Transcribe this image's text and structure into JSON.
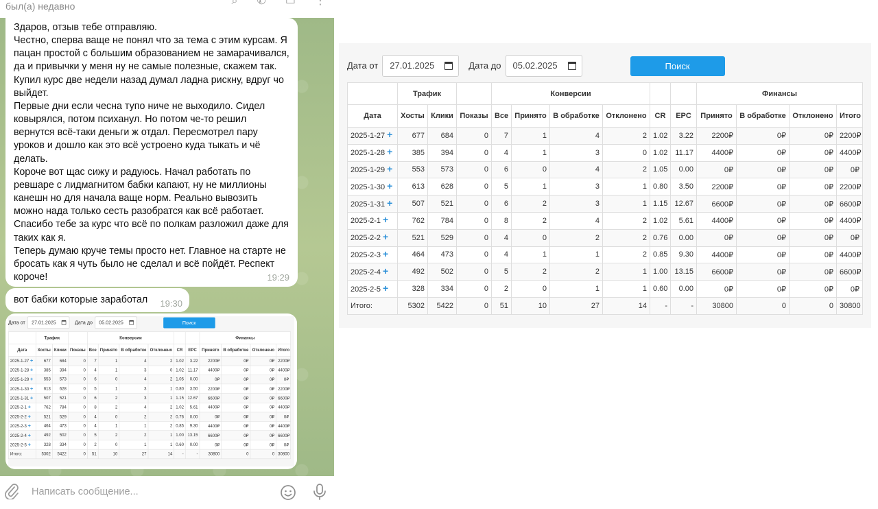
{
  "chat": {
    "status": "был(а) недавно",
    "messages": [
      {
        "text": "Здаров, отзыв тебе отправляю.\nЧестно, сперва ваще не понял что за тема с этим курсам. Я пацан простой с большим образованием не замарачивался, да и привычки у меня ну не самые полезные, скажем так. Купил курс две недели назад думал ладна рискну, вдруг чо выйдет.\nПервые дни если чесна тупо ниче не выходило. Сидел ковырялся, потом психанул. Но потом че-то решил вернутся всё-таки деньги ж отдал. Пересмотрел пару уроков и дошло как это всё устроено куда тыкать и чё делать.\nКороче вот щас сижу и радуюсь. Начал работать по ревшаре с лидмагнитом бабки капают, ну не миллионы канешн но для начала ваще норм. Реально вывозить можно нада только сесть разобратся как всё работает.\nСпасибо тебе за курс что всё по полкам разложил даже для таких как я.\nТеперь думаю круче темы просто нет. Главное на старте не бросать как я чуть было не сделал и всё пойдёт. Респект короче!",
        "time": "19:29"
      },
      {
        "text": "вот бабки которые заработал",
        "time": "19:30"
      }
    ],
    "composer_placeholder": "Написать сообщение..."
  },
  "report": {
    "date_from_label": "Дата от",
    "date_from_value": "27.01.2025",
    "date_to_label": "Дата до",
    "date_to_value": "05.02.2025",
    "search_button": "Поиск",
    "group_headers": {
      "traffic": "Трафик",
      "conversions": "Конверсии",
      "finance": "Финансы"
    },
    "columns": [
      "Дата",
      "Хосты",
      "Клики",
      "Показы",
      "Все",
      "Принято",
      "В обработке",
      "Отклонено",
      "CR",
      "EPC",
      "Принято",
      "В обработке",
      "Отклонено",
      "Итого"
    ],
    "rows": [
      [
        "2025-1-27",
        "677",
        "684",
        "0",
        "7",
        "1",
        "4",
        "2",
        "1.02",
        "3.22",
        "2200₽",
        "0₽",
        "0₽",
        "2200₽"
      ],
      [
        "2025-1-28",
        "385",
        "394",
        "0",
        "4",
        "1",
        "3",
        "0",
        "1.02",
        "11.17",
        "4400₽",
        "0₽",
        "0₽",
        "4400₽"
      ],
      [
        "2025-1-29",
        "553",
        "573",
        "0",
        "6",
        "0",
        "4",
        "2",
        "1.05",
        "0.00",
        "0₽",
        "0₽",
        "0₽",
        "0₽"
      ],
      [
        "2025-1-30",
        "613",
        "628",
        "0",
        "5",
        "1",
        "3",
        "1",
        "0.80",
        "3.50",
        "2200₽",
        "0₽",
        "0₽",
        "2200₽"
      ],
      [
        "2025-1-31",
        "507",
        "521",
        "0",
        "6",
        "2",
        "3",
        "1",
        "1.15",
        "12.67",
        "6600₽",
        "0₽",
        "0₽",
        "6600₽"
      ],
      [
        "2025-2-1",
        "762",
        "784",
        "0",
        "8",
        "2",
        "4",
        "2",
        "1.02",
        "5.61",
        "4400₽",
        "0₽",
        "0₽",
        "4400₽"
      ],
      [
        "2025-2-2",
        "521",
        "529",
        "0",
        "4",
        "0",
        "2",
        "2",
        "0.76",
        "0.00",
        "0₽",
        "0₽",
        "0₽",
        "0₽"
      ],
      [
        "2025-2-3",
        "464",
        "473",
        "0",
        "4",
        "1",
        "1",
        "2",
        "0.85",
        "9.30",
        "4400₽",
        "0₽",
        "0₽",
        "4400₽"
      ],
      [
        "2025-2-4",
        "492",
        "502",
        "0",
        "5",
        "2",
        "2",
        "1",
        "1.00",
        "13.15",
        "6600₽",
        "0₽",
        "0₽",
        "6600₽"
      ],
      [
        "2025-2-5",
        "328",
        "334",
        "0",
        "2",
        "0",
        "1",
        "1",
        "0.60",
        "0.00",
        "0₽",
        "0₽",
        "0₽",
        "0₽"
      ]
    ],
    "total": [
      "Итого:",
      "5302",
      "5422",
      "0",
      "51",
      "10",
      "27",
      "14",
      "-",
      "-",
      "30800",
      "0",
      "0",
      "30800"
    ]
  },
  "colors": {
    "accent": "#1e9be8",
    "chat_wallpaper": "#aabf8f",
    "plus": "#2a8fd8"
  },
  "icons": [
    "search-icon",
    "phone-icon",
    "sidebar-icon",
    "more-icon",
    "paperclip-icon",
    "emoji-icon",
    "microphone-icon",
    "calendar-icon",
    "plus-icon"
  ]
}
